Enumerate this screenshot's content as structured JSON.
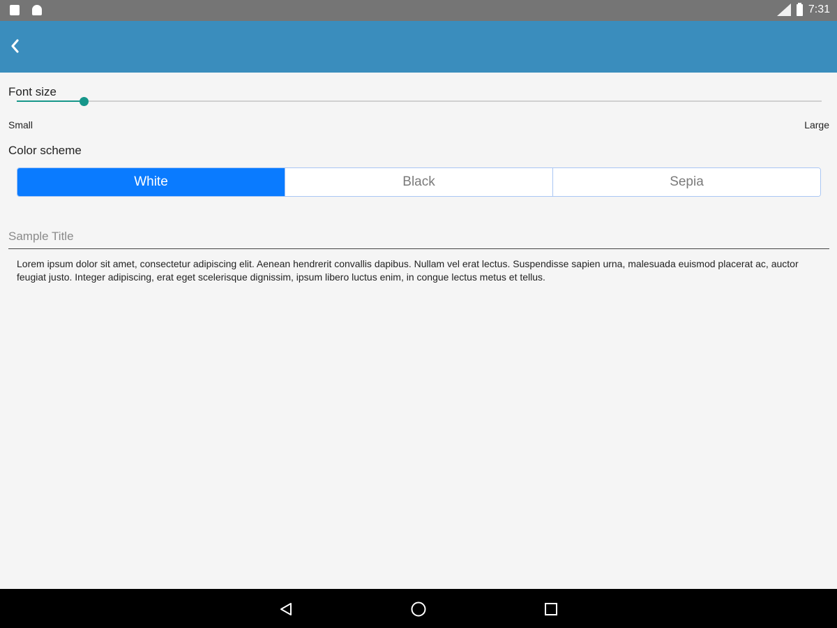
{
  "status_bar": {
    "time": "7:31",
    "icons": [
      "sd-card-icon",
      "android-icon",
      "signal-icon",
      "battery-icon"
    ]
  },
  "app_bar": {
    "color": "#3a8dbd",
    "back_icon": "chevron-left-icon"
  },
  "font_size": {
    "label": "Font size",
    "min_label": "Small",
    "max_label": "Large",
    "value_fraction": 0.083,
    "accent": "#16968a"
  },
  "color_scheme": {
    "label": "Color scheme",
    "options": [
      "White",
      "Black",
      "Sepia"
    ],
    "selected": "White",
    "accent": "#0a7bff"
  },
  "sample": {
    "title": "Sample Title",
    "body": "Lorem ipsum dolor sit amet, consectetur adipiscing elit. Aenean hendrerit convallis dapibus. Nullam vel erat lectus. Suspendisse sapien urna, malesuada euismod placerat ac, auctor feugiat justo. Integer adipiscing, erat eget scelerisque dignissim, ipsum libero luctus enim, in congue lectus metus et tellus."
  },
  "nav_bar": {
    "buttons": [
      "back-triangle-icon",
      "home-circle-icon",
      "recents-square-icon"
    ]
  }
}
